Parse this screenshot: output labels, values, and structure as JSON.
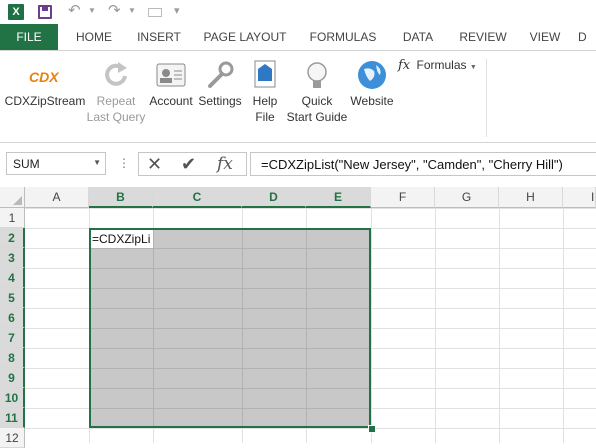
{
  "qat": {
    "logo_letter": "X",
    "undo_glyph": "↶",
    "redo_glyph": "↷",
    "more_glyph": "▾"
  },
  "tabs": [
    "FILE",
    "HOME",
    "INSERT",
    "PAGE LAYOUT",
    "FORMULAS",
    "DATA",
    "REVIEW",
    "VIEW",
    "D"
  ],
  "ribbon": {
    "cdx_logo": "CDX",
    "buttons": [
      {
        "label1": "CDXZipStream",
        "label2": "",
        "icon": "cdx-logo-icon"
      },
      {
        "label1": "Repeat",
        "label2": "Last Query",
        "icon": "repeat-icon",
        "disabled": true
      },
      {
        "label1": "Account",
        "label2": "",
        "icon": "account-card-icon"
      },
      {
        "label1": "Settings",
        "label2": "",
        "icon": "wrench-icon"
      },
      {
        "label1": "Help",
        "label2": "File",
        "icon": "help-file-icon"
      },
      {
        "label1": "Quick",
        "label2": "Start Guide",
        "icon": "lightbulb-icon"
      },
      {
        "label1": "Website",
        "label2": "",
        "icon": "globe-icon"
      }
    ],
    "formulas_menu": "Formulas",
    "fx_glyph": "fx"
  },
  "formula_bar": {
    "name_box": "SUM",
    "cancel_glyph": "✕",
    "enter_glyph": "✔",
    "fx_glyph": "fx",
    "formula": "=CDXZipList(\"New Jersey\", \"Camden\", \"Cherry Hill\")"
  },
  "grid": {
    "columns": [
      "A",
      "B",
      "C",
      "D",
      "E",
      "F",
      "G",
      "H",
      "I"
    ],
    "rows": [
      "1",
      "2",
      "3",
      "4",
      "5",
      "6",
      "7",
      "8",
      "9",
      "10",
      "11",
      "12"
    ],
    "selected_columns": [
      "B",
      "C",
      "D",
      "E"
    ],
    "selected_rows": [
      "2",
      "3",
      "4",
      "5",
      "6",
      "7",
      "8",
      "9",
      "10",
      "11"
    ],
    "active_cell_text": "=CDXZipLi"
  },
  "colors": {
    "accent": "#217346",
    "selection": "#c8c8c8"
  }
}
